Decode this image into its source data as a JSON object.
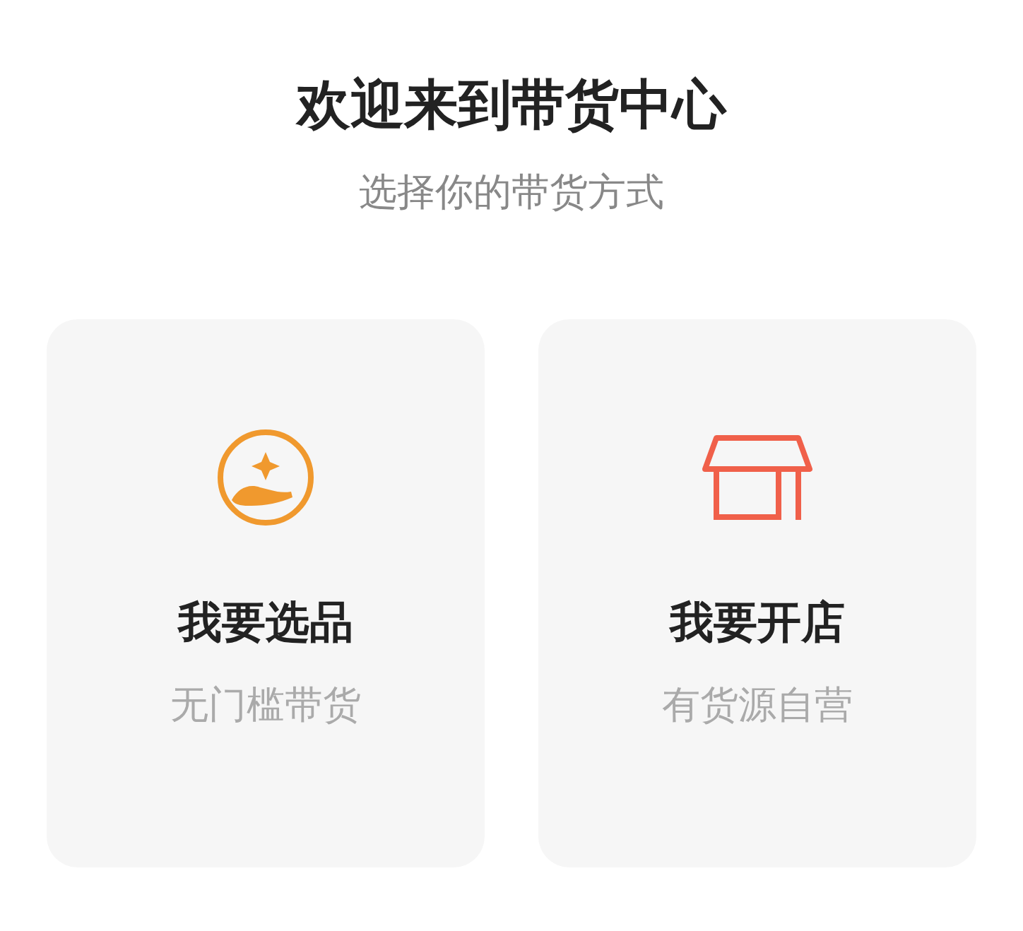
{
  "title": "欢迎来到带货中心",
  "subtitle": "选择你的带货方式",
  "options": [
    {
      "kind": "select",
      "title": "我要选品",
      "subtitle": "无门槛带货"
    },
    {
      "kind": "store",
      "title": "我要开店",
      "subtitle": "有货源自营"
    }
  ]
}
